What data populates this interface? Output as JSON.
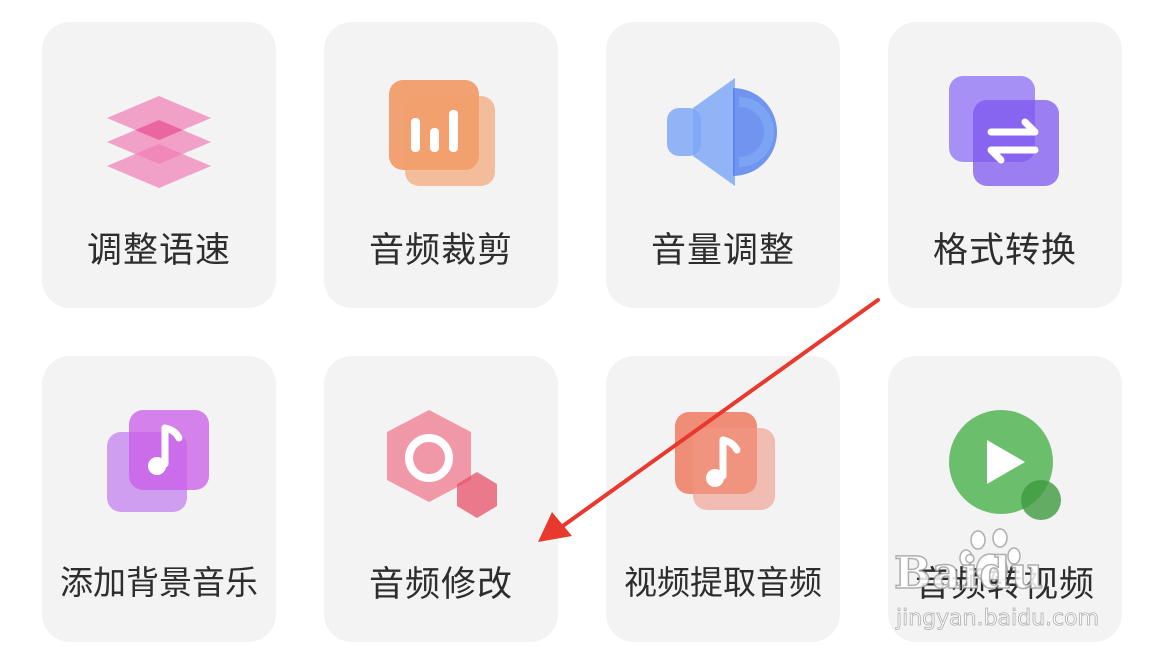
{
  "tools": [
    {
      "id": "speed",
      "label": "调整语速",
      "icon": "layers-icon"
    },
    {
      "id": "trim",
      "label": "音频裁剪",
      "icon": "bar-chart-icon"
    },
    {
      "id": "volume",
      "label": "音量调整",
      "icon": "speaker-icon"
    },
    {
      "id": "convert",
      "label": "格式转换",
      "icon": "swap-arrows-icon"
    },
    {
      "id": "bgm",
      "label": "添加背景音乐",
      "icon": "music-note-icon"
    },
    {
      "id": "edit",
      "label": "音频修改",
      "icon": "hexagon-ring-icon"
    },
    {
      "id": "extract",
      "label": "视频提取音频",
      "icon": "music-note-icon"
    },
    {
      "id": "to_video",
      "label": "音频转视频",
      "icon": "play-circle-icon"
    }
  ],
  "colors": {
    "tile_bg": "#f3f3f4",
    "label": "#2d2d2d",
    "pink": "#ef7eb4",
    "orange": "#f0925a",
    "blue": "#5d8df2",
    "purple": "#8a63f0",
    "violet": "#c95be8",
    "rose": "#ef8e9f",
    "coral": "#ee7a60",
    "green": "#5cb85c",
    "arrow": "#e8392f"
  },
  "watermark": {
    "brand": "Baidu",
    "url": "jingyan.baidu.com"
  }
}
